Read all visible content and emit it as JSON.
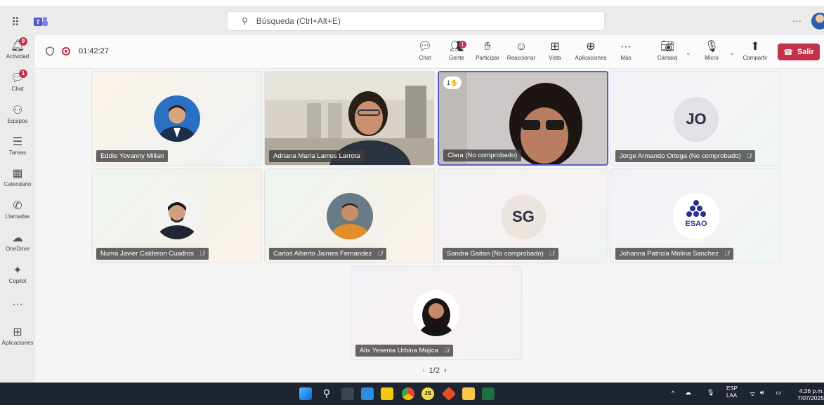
{
  "search": {
    "placeholder": "Búsqueda (Ctrl+Alt+E)"
  },
  "rail": [
    {
      "name": "actividad",
      "label": "Actividad",
      "icon": "bell-icon",
      "badge": "9"
    },
    {
      "name": "chat",
      "label": "Chat",
      "icon": "chat-icon",
      "badge": "1"
    },
    {
      "name": "equipos",
      "label": "Equipos",
      "icon": "teams-icon",
      "badge": ""
    },
    {
      "name": "tareas",
      "label": "Tareas",
      "icon": "tasks-icon",
      "badge": ""
    },
    {
      "name": "calendario",
      "label": "Calendario",
      "icon": "calendar-icon",
      "badge": ""
    },
    {
      "name": "llamadas",
      "label": "Llamadas",
      "icon": "phone-icon",
      "badge": ""
    },
    {
      "name": "onedrive",
      "label": "OneDrive",
      "icon": "cloud-icon",
      "badge": ""
    },
    {
      "name": "copilot",
      "label": "Copilot",
      "icon": "copilot-icon",
      "badge": ""
    },
    {
      "name": "more",
      "label": "",
      "icon": "more-icon",
      "badge": ""
    },
    {
      "name": "aplicaciones",
      "label": "Aplicaciones",
      "icon": "apps-icon",
      "badge": ""
    }
  ],
  "meeting": {
    "timer": "01:42:27",
    "tools": {
      "chat": "Chat",
      "gente": "Gente",
      "gente_badge": "1",
      "participar": "Participar",
      "reaccionar": "Reaccionar",
      "vista": "Vista",
      "aplicaciones": "Aplicaciones",
      "mas": "Más",
      "camara": "Cámara",
      "micro": "Micro",
      "compartir": "Compartir"
    },
    "leave": "Salir"
  },
  "participants": [
    {
      "name": "Eddie Yovanny Millan",
      "muted": false,
      "type": "photo"
    },
    {
      "name": "Adriana María Lamus Larrota",
      "muted": false,
      "type": "video"
    },
    {
      "name": "Clara (No comprobado)",
      "muted": false,
      "type": "video",
      "reaction": "1✋"
    },
    {
      "name": "Jorge Armando Ortega (No comprobado)",
      "muted": true,
      "type": "initials",
      "initials": "JO"
    },
    {
      "name": "Numa Javier Calderon Cuadros",
      "muted": true,
      "type": "photo"
    },
    {
      "name": "Carlos Alberto Jaimes Fernandez",
      "muted": true,
      "type": "photo"
    },
    {
      "name": "Sandra Gaitan (No comprobado)",
      "muted": true,
      "type": "initials",
      "initials": "SG"
    },
    {
      "name": "Johanna Patricia Molina Sanchez",
      "muted": true,
      "type": "logo",
      "logo_text": "ESAO"
    },
    {
      "name": "Alix Yesenia Urbina Mojica",
      "muted": true,
      "type": "photo"
    }
  ],
  "pager": {
    "label": "1/2"
  },
  "taskbar": {
    "lang": "ESP",
    "layout": "LAA",
    "time": "4:26 p.m.",
    "date": "7/07/2025"
  },
  "colors": {
    "leave": "#c4314b",
    "accent": "#5b5fc7",
    "badge": "#c4314b"
  }
}
